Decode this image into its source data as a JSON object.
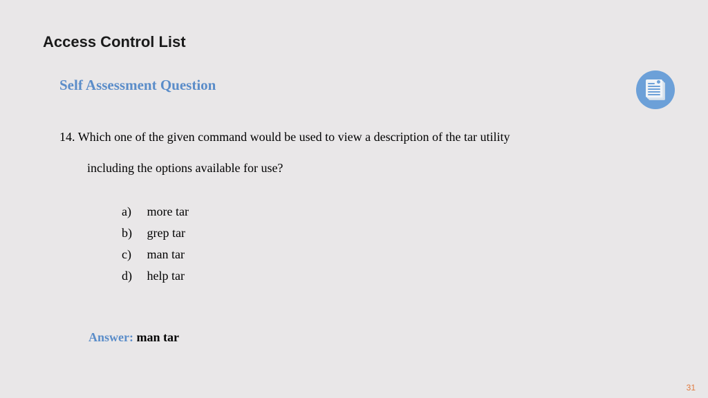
{
  "title": "Access Control List",
  "section": "Self Assessment Question",
  "question": {
    "number": "14.",
    "text_line1": "Which one of the given command would be used to view a description of the tar utility",
    "text_line2": "including the options available for use?"
  },
  "options": [
    {
      "letter": "a)",
      "text": "more tar"
    },
    {
      "letter": "b)",
      "text": "grep tar"
    },
    {
      "letter": "c)",
      "text": "man tar"
    },
    {
      "letter": "d)",
      "text": "help tar"
    }
  ],
  "answer": {
    "label": "Answer:",
    "text": "man tar"
  },
  "page_number": "31"
}
